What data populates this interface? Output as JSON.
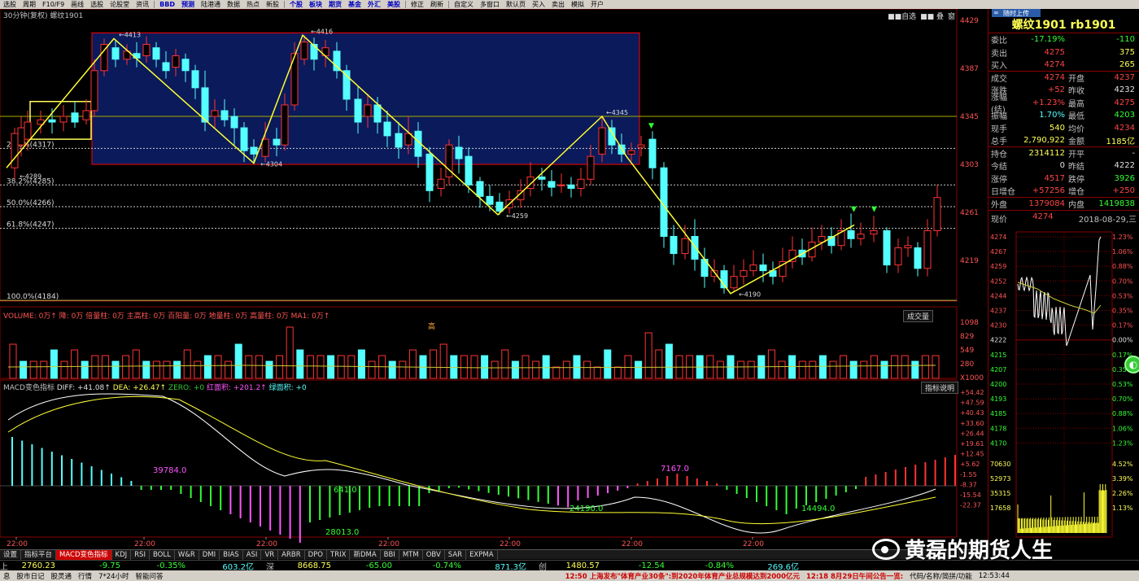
{
  "menu": {
    "items": [
      "选股",
      "周期",
      "F10/F9",
      "画线",
      "选股",
      "论股堂",
      "资讯",
      "BBD",
      "预测",
      "陆港通",
      "数据",
      "热点",
      "新股",
      "个股",
      "板块",
      "期货",
      "基金",
      "外汇",
      "美股",
      "修正",
      "刷新",
      "自定义",
      "多窗口",
      "默认页",
      "买入",
      "卖出",
      "模拟",
      "开户"
    ]
  },
  "chart": {
    "title": "30分钟(复权) 螺纹1901",
    "tools": [
      "■■自选",
      "■■ 叠",
      "窗"
    ],
    "price_axis": [
      "4429",
      "4387",
      "4345",
      "4303",
      "4261",
      "4219"
    ],
    "annotations": [
      "4413",
      "4416",
      "4304",
      "4345",
      "4289",
      "4259",
      "4190"
    ],
    "fib": [
      "100.0%(4184)",
      "61.8%(4247)",
      "50.0%(4266)",
      "38.2%(4285)",
      "23.6%(4317)"
    ],
    "time_axis": [
      "22:00",
      "22:00",
      "22:00",
      "22:00",
      "22:00",
      "22:00",
      "22:00"
    ]
  },
  "volume": {
    "legend": "VOLUME: 0万↑ 降: 0万 倍量柱: 0万 主高柱: 0万 百阳量: 0万 地量柱: 0万 高量柱: 0万 MA1: 0万↑",
    "switch_label": "成交量",
    "axis": [
      "1098",
      "829",
      "549",
      "280",
      "X1000"
    ],
    "peak_label": "高"
  },
  "macd": {
    "legend_parts": [
      {
        "text": "MACD变色指标",
        "color": "#c0c0c0"
      },
      {
        "text": "DIFF: +41.08↑",
        "color": "#e0e0e0"
      },
      {
        "text": "DEA: +26.47↑",
        "color": "#ffff55"
      },
      {
        "text": "ZERO: +0",
        "color": "#33cc33"
      },
      {
        "text": "红面积: +201.2↑",
        "color": "#ff55ff"
      },
      {
        "text": "绿面积: +0",
        "color": "#55ffff"
      }
    ],
    "help_label": "指标说明",
    "axis": [
      "+54.42",
      "+47.59",
      "+40.43",
      "+33.60",
      "+26.44",
      "+19.61",
      "+12.45",
      "+5.62",
      "-1.55",
      "-8.37",
      "-15.54",
      "-22.37"
    ],
    "value_labels": [
      "39784.0",
      "641.0",
      "28013.0",
      "24190.0",
      "7167.0",
      "14494.0"
    ]
  },
  "tabs": [
    "设置",
    "指标平台",
    "MACD变色指标",
    "KDJ",
    "RSI",
    "BOLL",
    "W&R",
    "DMI",
    "BIAS",
    "ASI",
    "VR",
    "ARBR",
    "DPO",
    "TRIX",
    "新DMA",
    "BBI",
    "MTM",
    "OBV",
    "SAR",
    "EXPMA"
  ],
  "index_bar": {
    "sh_value": "2760.23",
    "sh_chg": "-9.75",
    "sh_pct": "-0.35%",
    "sh_amt": "603.2亿",
    "sz_label": "深",
    "sz_value": "8668.75",
    "sz_chg": "-65.00",
    "sz_pct": "-0.74%",
    "sz_amt": "871.3亿",
    "cy_label": "创",
    "cy_value": "1480.57",
    "cy_chg": "-12.54",
    "cy_pct": "-0.84%",
    "cy_amt": "269.6亿"
  },
  "status": {
    "left": [
      "息",
      "股市日记",
      "股灵通",
      "行情",
      "7*24小时",
      "智能问答"
    ],
    "news1": "12:50 上海发布\"体育产业30条\":到2020年体育产业总规模达到2000亿元",
    "news2": "12:18 8月29日午间公告一览:",
    "right": "代码/名称/简拼/功能",
    "clock": "12:53:44"
  },
  "watermark": "黄磊的期货人生",
  "panel": {
    "top_badge": "随时上传",
    "title": "螺纹1901 rb1901",
    "rows": [
      {
        "l1": "委比",
        "v1": "-17.19%",
        "c1": "green",
        "l2": "",
        "v2": "-110",
        "c2": "green"
      },
      {
        "l1": "卖出",
        "v1": "4275",
        "c1": "red",
        "l2": "",
        "v2": "375",
        "c2": "yellow"
      },
      {
        "l1": "买入",
        "v1": "4274",
        "c1": "red",
        "l2": "",
        "v2": "265",
        "c2": "yellow"
      },
      {
        "l1": "成交",
        "v1": "4274",
        "c1": "red",
        "l2": "开盘",
        "v2": "4237",
        "c2": "red"
      },
      {
        "l1": "涨跌",
        "v1": "+52",
        "c1": "red",
        "l2": "昨收",
        "v2": "4232",
        "c2": "white"
      },
      {
        "l1": "涨幅(结)",
        "v1": "+1.23%",
        "c1": "red",
        "l2": "最高",
        "v2": "4275",
        "c2": "red"
      },
      {
        "l1": "振幅",
        "v1": "1.70%",
        "c1": "cyan",
        "l2": "最低",
        "v2": "4203",
        "c2": "green"
      },
      {
        "l1": "现手",
        "v1": "540",
        "c1": "yellow",
        "l2": "均价",
        "v2": "4234",
        "c2": "red"
      },
      {
        "l1": "总手",
        "v1": "2,790,922",
        "c1": "yellow",
        "l2": "金额",
        "v2": "1185亿",
        "c2": "yellow"
      },
      {
        "l1": "持仓",
        "v1": "2314112",
        "c1": "yellow",
        "l2": "开平",
        "v2": "-",
        "c2": "white"
      },
      {
        "l1": "今结",
        "v1": "0",
        "c1": "white",
        "l2": "昨结",
        "v2": "4222",
        "c2": "white"
      },
      {
        "l1": "涨停",
        "v1": "4517",
        "c1": "red",
        "l2": "跌停",
        "v2": "3926",
        "c2": "green"
      },
      {
        "l1": "日增仓",
        "v1": "+57256",
        "c1": "red",
        "l2": "增仓",
        "v2": "+250",
        "c2": "red"
      },
      {
        "l1": "外盘",
        "v1": "1379084",
        "c1": "red",
        "l2": "内盘",
        "v2": "1419838",
        "c2": "green"
      }
    ],
    "now_label": "现价",
    "now_value": "4274",
    "date": "2018-08-29,三",
    "intraday_left": [
      "4274",
      "4267",
      "4259",
      "4252",
      "4244",
      "4237",
      "4230",
      "4222",
      "4215",
      "4207",
      "4200",
      "4193",
      "4185",
      "4178",
      "4170"
    ],
    "intraday_right": [
      "1.23%",
      "1.06%",
      "0.88%",
      "0.70%",
      "0.53%",
      "0.35%",
      "0.17%",
      "0.00%",
      "0.17%",
      "0.35%",
      "0.53%",
      "0.70%",
      "0.88%",
      "1.06%",
      "1.23%"
    ],
    "vol_left": [
      "70630",
      "52973",
      "35315",
      "17658"
    ],
    "vol_right": [
      "4.52%",
      "3.39%",
      "2.26%",
      "1.13%"
    ]
  }
}
